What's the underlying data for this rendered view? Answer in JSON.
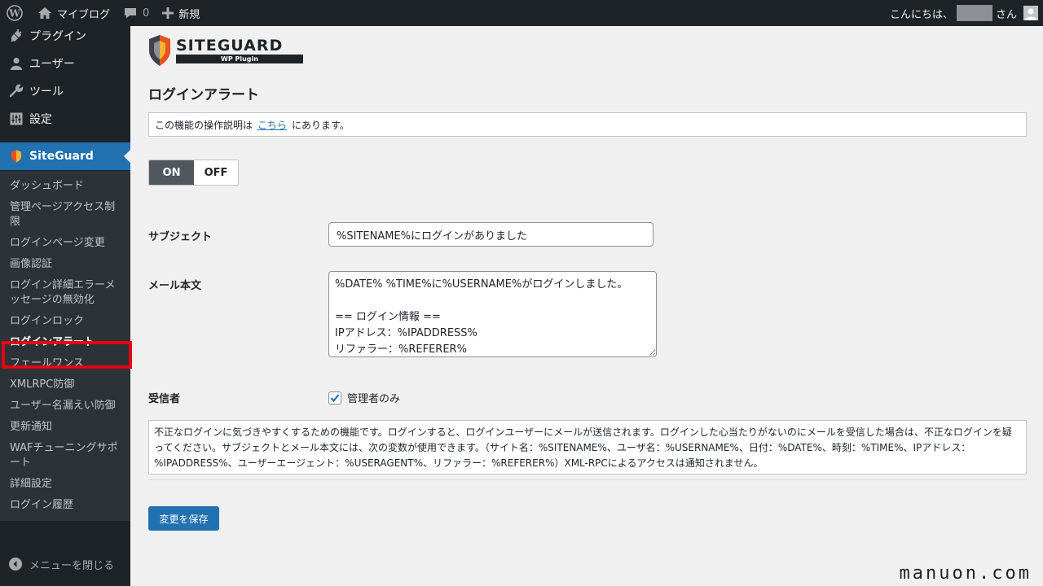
{
  "adminbar": {
    "site_name": "マイブログ",
    "comment_count": "0",
    "new_label": "新規",
    "greeting": "こんにちは、",
    "san": "さん",
    "icons": [
      "wordpress-logo-icon",
      "home-icon",
      "comment-icon",
      "plus-icon",
      "avatar-icon"
    ]
  },
  "sidebar": {
    "top_items": [
      {
        "label": "プラグイン",
        "icon": "plugin-icon"
      },
      {
        "label": "ユーザー",
        "icon": "user-icon"
      },
      {
        "label": "ツール",
        "icon": "wrench-icon"
      },
      {
        "label": "設定",
        "icon": "settings-icon"
      }
    ],
    "current_menu": {
      "label": "SiteGuard",
      "icon": "siteguard-shield-icon"
    },
    "submenu": [
      "ダッシュボード",
      "管理ページアクセス制限",
      "ログインページ変更",
      "画像認証",
      "ログイン詳細エラーメッセージの無効化",
      "ログインロック",
      "ログインアラート",
      "フェールワンス",
      "XMLRPC防御",
      "ユーザー名漏えい防御",
      "更新通知",
      "WAFチューニングサポート",
      "詳細設定",
      "ログイン履歴"
    ],
    "current_submenu": "ログインアラート",
    "collapse_label": "メニューを閉じる"
  },
  "logo": {
    "brand": "SITEGUARD",
    "sub": "WP Plugin",
    "accent": "#e8531f"
  },
  "page": {
    "title": "ログインアラート",
    "notice_prefix": "この機能の操作説明は",
    "notice_link": "こちら",
    "notice_suffix": "にあります。",
    "toggle_on": "ON",
    "toggle_off": "OFF",
    "subject_label": "サブジェクト",
    "subject_value": "%SITENAME%にログインがありました",
    "body_label": "メール本文",
    "body_value": "%DATE% %TIME%に%USERNAME%がログインしました。\n\n== ログイン情報 ==\nIPアドレス：%IPADDRESS%\nリファラー：%REFERER%",
    "recipient_label": "受信者",
    "recipient_option": "管理者のみ",
    "recipient_checked": true,
    "description": "不正なログインに気づきやすくするための機能です。ログインすると、ログインユーザーにメールが送信されます。ログインした心当たりがないのにメールを受信した場合は、不正なログインを疑ってください。サブジェクトとメール本文には、次の変数が使用できます。（サイト名：%SITENAME%、ユーザ名：%USERNAME%、日付：%DATE%、時刻：%TIME%、IPアドレス：%IPADDRESS%、ユーザーエージェント：%USERAGENT%、リファラー：%REFERER%）XML-RPCによるアクセスは通知されません。",
    "save_label": "変更を保存"
  },
  "watermark": "manuon.com",
  "colors": {
    "admin_dark": "#1d2327",
    "primary": "#2271b1",
    "highlight_box": "#e60012"
  }
}
